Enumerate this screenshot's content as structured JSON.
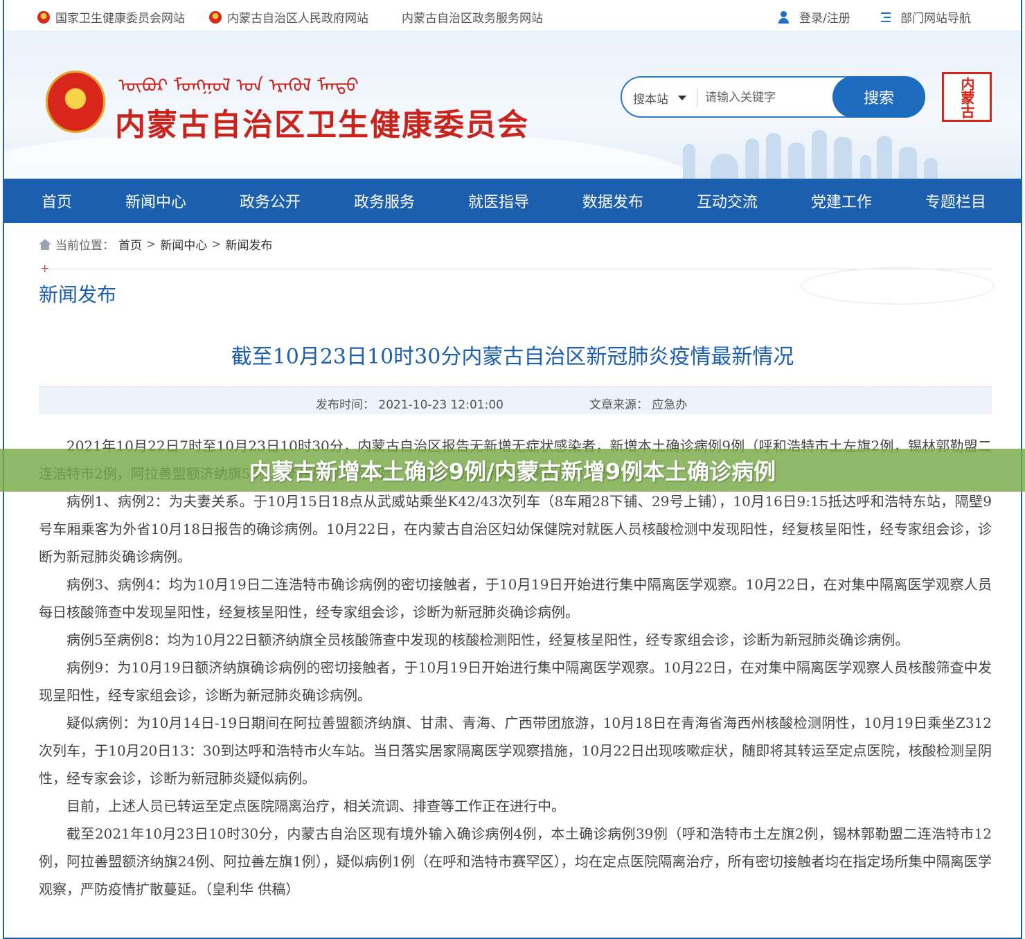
{
  "topbar": {
    "links": [
      "国家卫生健康委员会网站",
      "内蒙古自治区人民政府网站",
      "内蒙古自治区政务服务网站"
    ],
    "login": "登录/注册",
    "dept_nav": "部门网站导航"
  },
  "header": {
    "mongolian": "ᠥᠪᠦᠷ ᠮᠣᠩᠭᠣᠯ ᠤᠨ ᠡᠷᠡᠭᠦᠯ ᠮᠡᠨᠳᠦ",
    "site_title": "内蒙古自治区卫生健康委员会",
    "seal_text": "内蒙古"
  },
  "search": {
    "scope": "搜本站",
    "placeholder": "请输入关键字",
    "button": "搜索"
  },
  "nav": [
    "首页",
    "新闻中心",
    "政务公开",
    "政务服务",
    "就医指导",
    "数据发布",
    "互动交流",
    "党建工作",
    "专题栏目"
  ],
  "breadcrumb": {
    "label": "当前位置：",
    "items": [
      "首页",
      "新闻中心",
      "新闻发布"
    ],
    "sep": ">"
  },
  "section_title": "新闻发布",
  "article": {
    "title": "截至10月23日10时30分内蒙古自治区新冠肺炎疫情最新情况",
    "published": "发布时间： 2021-10-23 12:01:00",
    "source": "文章来源： 应急办",
    "paragraphs": [
      "2021年10月22日7时至10月23日10时30分，内蒙古自治区报告无新增无症状感染者，新增本土确诊病例9例（呼和浩特市土左旗2例，锡林郭勒盟二连浩特市2例，阿拉善盟额济纳旗5例）。新增疑似病例1例。现将确诊病例和疑似病例具体情况如下：",
      "病例1、病例2：为夫妻关系。于10月15日18点从武威站乘坐K42/43次列车（8车厢28下铺、29号上铺），10月16日9:15抵达呼和浩特东站，隔壁9号车厢乘客为外省10月18日报告的确诊病例。10月22日，在内蒙古自治区妇幼保健院对就医人员核酸检测中发现阳性，经复核呈阳性，经专家组会诊，诊断为新冠肺炎确诊病例。",
      "病例3、病例4：均为10月19日二连浩特市确诊病例的密切接触者，于10月19日开始进行集中隔离医学观察。10月22日，在对集中隔离医学观察人员每日核酸筛查中发现呈阳性，经复核呈阳性，经专家组会诊，诊断为新冠肺炎确诊病例。",
      "病例5至病例8：均为10月22日额济纳旗全员核酸筛查中发现的核酸检测阳性，经复核呈阳性，经专家组会诊，诊断为新冠肺炎确诊病例。",
      "病例9：为10月19日额济纳旗确诊病例的密切接触者，于10月19日开始进行集中隔离医学观察。10月22日，在对集中隔离医学观察人员核酸筛查中发现呈阳性，经专家组会诊，诊断为新冠肺炎确诊病例。",
      "疑似病例：为10月14日-19日期间在阿拉善盟额济纳旗、甘肃、青海、广西带团旅游，10月18日在青海省海西州核酸检测阴性，10月19日乘坐Z312次列车，于10月20日13：30到达呼和浩特市火车站。当日落实居家隔离医学观察措施，10月22日出现咳嗽症状，随即将其转运至定点医院，核酸检测呈阴性，经专家会诊，诊断为新冠肺炎疑似病例。",
      "目前，上述人员已转运至定点医院隔离治疗，相关流调、排查等工作正在进行中。",
      "截至2021年10月23日10时30分，内蒙古自治区现有境外输入确诊病例4例，本土确诊病例39例（呼和浩特市土左旗2例，锡林郭勒盟二连浩特市12例，阿拉善盟额济纳旗24例、阿拉善左旗1例），疑似病例1例（在呼和浩特市赛罕区），均在定点医院隔离治疗，所有密切接触者均在指定场所集中隔离医学观察，严防疫情扩散蔓延。（皇利华 供稿）"
    ]
  },
  "overlay_caption": "内蒙古新增本土确诊9例/内蒙古新增9例本土确诊病例",
  "colors": {
    "brand_blue": "#1b5fae",
    "title_red": "#c8241c",
    "overlay_green": "#78aa46"
  }
}
